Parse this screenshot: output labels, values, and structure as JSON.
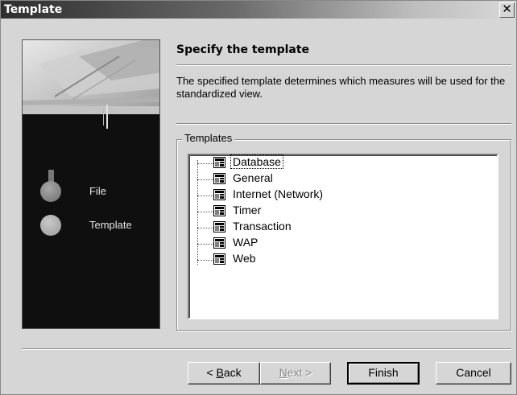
{
  "window": {
    "title": "Template",
    "close_glyph": "✕"
  },
  "wizard": {
    "heading": "Specify the template",
    "description": "The specified template determines which measures will be used for the standardized view.",
    "steps": [
      {
        "label": "File",
        "state": "completed"
      },
      {
        "label": "Template",
        "state": "current"
      }
    ]
  },
  "templates_group": {
    "legend": "Templates",
    "items": [
      {
        "label": "Database",
        "icon": "template-icon",
        "selected": true
      },
      {
        "label": "General",
        "icon": "template-icon",
        "selected": false
      },
      {
        "label": "Internet (Network)",
        "icon": "template-icon",
        "selected": false
      },
      {
        "label": "Timer",
        "icon": "template-icon",
        "selected": false
      },
      {
        "label": "Transaction",
        "icon": "template-icon",
        "selected": false
      },
      {
        "label": "WAP",
        "icon": "template-icon",
        "selected": false
      },
      {
        "label": "Web",
        "icon": "template-icon",
        "selected": false
      }
    ]
  },
  "buttons": {
    "back": {
      "label_prefix": "< ",
      "label_mnemonic": "B",
      "label_rest": "ack"
    },
    "next": {
      "label_mnemonic": "N",
      "label_rest": "ext >",
      "enabled": false
    },
    "finish": {
      "label": "Finish"
    },
    "cancel": {
      "label": "Cancel"
    }
  },
  "colors": {
    "face": "#d6d6d6",
    "side_panel": "#0f0f0f",
    "step_dot": "#8c8c8c"
  }
}
